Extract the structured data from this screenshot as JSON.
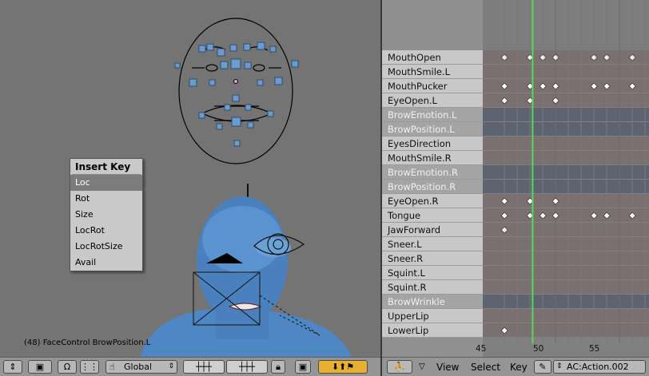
{
  "viewport": {
    "status_text": "(48) FaceControl BrowPosition.L"
  },
  "insert_key_menu": {
    "title": "Insert Key",
    "items": [
      "Loc",
      "Rot",
      "Size",
      "LocRot",
      "LocRotSize",
      "Avail"
    ],
    "active_index": 0
  },
  "action_editor": {
    "channels": [
      {
        "name": "MouthOpen",
        "dim": false
      },
      {
        "name": "MouthSmile.L",
        "dim": false
      },
      {
        "name": "MouthPucker",
        "dim": false
      },
      {
        "name": "EyeOpen.L",
        "dim": false
      },
      {
        "name": "BrowEmotion.L",
        "dim": true
      },
      {
        "name": "BrowPosition.L",
        "dim": true
      },
      {
        "name": "EyesDirection",
        "dim": false
      },
      {
        "name": "MouthSmile.R",
        "dim": false
      },
      {
        "name": "BrowEmotion.R",
        "dim": true
      },
      {
        "name": "BrowPosition.R",
        "dim": true
      },
      {
        "name": "EyeOpen.R",
        "dim": false
      },
      {
        "name": "Tongue",
        "dim": false
      },
      {
        "name": "JawForward",
        "dim": false
      },
      {
        "name": "Sneer.L",
        "dim": false
      },
      {
        "name": "Sneer.R",
        "dim": false
      },
      {
        "name": "Squint.L",
        "dim": false
      },
      {
        "name": "Squint.R",
        "dim": false
      },
      {
        "name": "BrowWrinkle",
        "dim": true
      },
      {
        "name": "UpperLip",
        "dim": false
      },
      {
        "name": "LowerLip",
        "dim": false
      }
    ],
    "keyframes": [
      [
        46,
        48,
        49,
        50,
        53,
        54,
        56
      ],
      [],
      [
        46,
        48,
        49,
        50,
        53,
        54,
        56
      ],
      [
        46,
        48,
        50
      ],
      [],
      [],
      [],
      [],
      [],
      [],
      [
        46,
        48,
        50
      ],
      [
        46,
        48,
        49,
        50,
        53,
        54,
        56
      ],
      [
        46
      ],
      [],
      [],
      [],
      [],
      [],
      [],
      [
        46
      ]
    ],
    "current_frame": 48.2,
    "ruler_labels": [
      "45",
      "50",
      "55"
    ],
    "frame_range": [
      44.3,
      57.3
    ]
  },
  "viewport_header": {
    "orientation": "Global"
  },
  "action_header": {
    "menus": [
      "View",
      "Select",
      "Key"
    ],
    "action_name": "AC:Action.002"
  },
  "colors": {
    "viewport_bg": "#747474",
    "bone_blue": "#5d8fb8",
    "head_blue": "#4a80bd",
    "frame_line": "#58d85a",
    "key_fill": "#ffffff"
  }
}
